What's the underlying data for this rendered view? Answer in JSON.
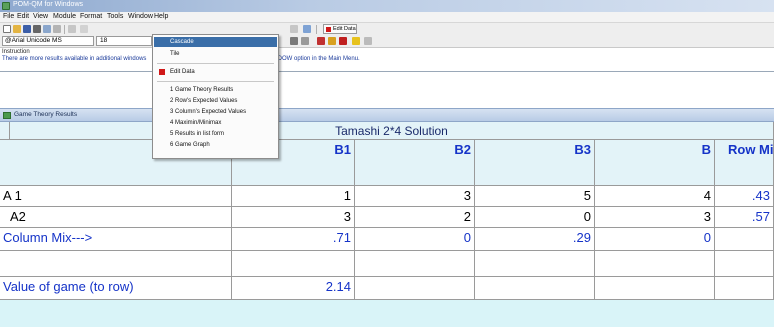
{
  "window": {
    "title": "POM-QM for Windows"
  },
  "menubar": {
    "items": [
      "File",
      "Edit",
      "View",
      "Module",
      "Format",
      "Tools",
      "Window",
      "Help"
    ]
  },
  "toolbar": {
    "font_name": "@Arial Unicode MS",
    "font_size": "18",
    "edit_data_label": "Edit Data"
  },
  "instruction": {
    "label": "Instruction",
    "text": "There are more results available in additional windows",
    "text_tail": "WINDOW option in the Main Menu."
  },
  "window_menu": {
    "items": [
      "Cascade",
      "Tile",
      "Edit Data",
      "1 Game Theory Results",
      "2 Row's Expected Values",
      "3 Column's Expected Values",
      "4 Maximin/Minimax",
      "5 Results in list form",
      "6 Game Graph"
    ],
    "selected": "Cascade"
  },
  "results": {
    "panel_title": "Game Theory Results",
    "solution_title": "Tamashi 2*4 Solution",
    "columns": [
      "B1",
      "B2",
      "B3",
      "B",
      "Row Mix"
    ],
    "rows": [
      {
        "label": "A 1",
        "values": [
          "1",
          "3",
          "5",
          "4",
          ".43"
        ]
      },
      {
        "label": "A2",
        "values": [
          "3",
          "2",
          "0",
          "3",
          ".57"
        ]
      }
    ],
    "column_mix": {
      "label": "Column Mix--->",
      "values": [
        ".71",
        "0",
        ".29",
        "0",
        ""
      ]
    },
    "value_of_game": {
      "label": "Value of game  (to row)",
      "value": "2.14"
    }
  },
  "colors": {
    "grid_bg": "#d9f4f8",
    "blue_text": "#1533c8",
    "menu_highlight": "#3a6ea8"
  }
}
